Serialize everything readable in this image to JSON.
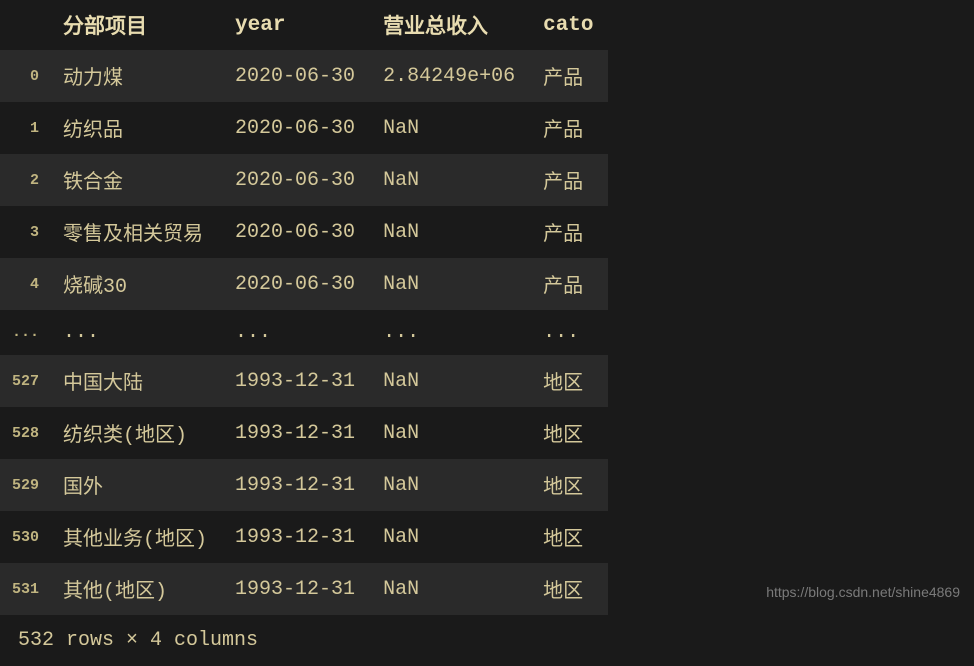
{
  "table": {
    "headers": {
      "index": "",
      "item": "分部项目",
      "year": "year",
      "revenue": "营业总收入",
      "cato": "cato"
    },
    "rows": [
      {
        "index": "0",
        "item": "动力煤",
        "year": "2020-06-30",
        "revenue": "2.84249e+06",
        "cato": "产品"
      },
      {
        "index": "1",
        "item": "纺织品",
        "year": "2020-06-30",
        "revenue": "NaN",
        "cato": "产品"
      },
      {
        "index": "2",
        "item": "铁合金",
        "year": "2020-06-30",
        "revenue": "NaN",
        "cato": "产品"
      },
      {
        "index": "3",
        "item": "零售及相关贸易",
        "year": "2020-06-30",
        "revenue": "NaN",
        "cato": "产品"
      },
      {
        "index": "4",
        "item": "烧碱30",
        "year": "2020-06-30",
        "revenue": "NaN",
        "cato": "产品"
      },
      {
        "index": "...",
        "item": "...",
        "year": "...",
        "revenue": "...",
        "cato": "..."
      },
      {
        "index": "527",
        "item": "中国大陆",
        "year": "1993-12-31",
        "revenue": "NaN",
        "cato": "地区"
      },
      {
        "index": "528",
        "item": "纺织类(地区)",
        "year": "1993-12-31",
        "revenue": "NaN",
        "cato": "地区"
      },
      {
        "index": "529",
        "item": "国外",
        "year": "1993-12-31",
        "revenue": "NaN",
        "cato": "地区"
      },
      {
        "index": "530",
        "item": "其他业务(地区)",
        "year": "1993-12-31",
        "revenue": "NaN",
        "cato": "地区"
      },
      {
        "index": "531",
        "item": "其他(地区)",
        "year": "1993-12-31",
        "revenue": "NaN",
        "cato": "地区"
      }
    ],
    "summary": "532 rows × 4 columns"
  },
  "watermark": "https://blog.csdn.net/shine4869"
}
